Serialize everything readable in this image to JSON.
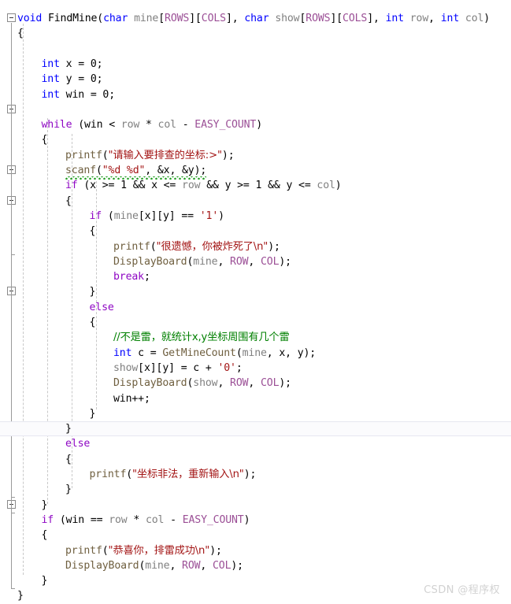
{
  "editor": {
    "background": "#ffffff",
    "current_line_index": 26,
    "font_size_px": 13.2,
    "line_height_px": 19.3,
    "colors": {
      "keyword": "#0000ff",
      "control_keyword": "#8f08c4",
      "macro": "#9b4f96",
      "string": "#a31515",
      "comment": "#008000",
      "function": "#6f5f3f",
      "variable": "#808080",
      "plain": "#000000",
      "squiggle": "#1f9d1f",
      "current_line_border": "#e6e7f0",
      "indent_guide": "#c8c8c8",
      "fold_line": "#9a9a9a",
      "watermark": "#d2d2d2"
    }
  },
  "gutter": {
    "fold_boxes": [
      {
        "line": 0,
        "state": "expanded"
      },
      {
        "line": 6,
        "state": "expanded"
      },
      {
        "line": 10,
        "state": "expanded"
      },
      {
        "line": 12,
        "state": "expanded"
      },
      {
        "line": 18,
        "state": "expanded"
      },
      {
        "line": 27,
        "state": "expanded"
      },
      {
        "line": 32,
        "state": "expanded"
      }
    ]
  },
  "code_lines": [
    {
      "indent": 0,
      "tokens": [
        {
          "t": "void",
          "c": "kw"
        },
        {
          "t": " ",
          "c": "plain"
        },
        {
          "t": "FindMine",
          "c": "plain"
        },
        {
          "t": "(",
          "c": "plain"
        },
        {
          "t": "char",
          "c": "kw"
        },
        {
          "t": " ",
          "c": "plain"
        },
        {
          "t": "mine",
          "c": "var"
        },
        {
          "t": "[",
          "c": "plain"
        },
        {
          "t": "ROWS",
          "c": "macro"
        },
        {
          "t": "][",
          "c": "plain"
        },
        {
          "t": "COLS",
          "c": "macro"
        },
        {
          "t": "], ",
          "c": "plain"
        },
        {
          "t": "char",
          "c": "kw"
        },
        {
          "t": " ",
          "c": "plain"
        },
        {
          "t": "show",
          "c": "var"
        },
        {
          "t": "[",
          "c": "plain"
        },
        {
          "t": "ROWS",
          "c": "macro"
        },
        {
          "t": "][",
          "c": "plain"
        },
        {
          "t": "COLS",
          "c": "macro"
        },
        {
          "t": "], ",
          "c": "plain"
        },
        {
          "t": "int",
          "c": "kw"
        },
        {
          "t": " ",
          "c": "plain"
        },
        {
          "t": "row",
          "c": "var"
        },
        {
          "t": ", ",
          "c": "plain"
        },
        {
          "t": "int",
          "c": "kw"
        },
        {
          "t": " ",
          "c": "plain"
        },
        {
          "t": "col",
          "c": "var"
        },
        {
          "t": ")",
          "c": "plain"
        }
      ]
    },
    {
      "indent": 0,
      "tokens": [
        {
          "t": "{",
          "c": "plain"
        }
      ]
    },
    {
      "indent": 0,
      "tokens": []
    },
    {
      "indent": 1,
      "tokens": [
        {
          "t": "int",
          "c": "kw"
        },
        {
          "t": " x = 0;",
          "c": "plain"
        }
      ]
    },
    {
      "indent": 1,
      "tokens": [
        {
          "t": "int",
          "c": "kw"
        },
        {
          "t": " y = 0;",
          "c": "plain"
        }
      ]
    },
    {
      "indent": 1,
      "tokens": [
        {
          "t": "int",
          "c": "kw"
        },
        {
          "t": " win = 0;",
          "c": "plain"
        }
      ]
    },
    {
      "indent": 0,
      "tokens": []
    },
    {
      "indent": 1,
      "tokens": [
        {
          "t": "while",
          "c": "kwctl"
        },
        {
          "t": " (",
          "c": "plain"
        },
        {
          "t": "win",
          "c": "plain"
        },
        {
          "t": " < ",
          "c": "plain"
        },
        {
          "t": "row",
          "c": "var"
        },
        {
          "t": " * ",
          "c": "plain"
        },
        {
          "t": "col",
          "c": "var"
        },
        {
          "t": " - ",
          "c": "plain"
        },
        {
          "t": "EASY_COUNT",
          "c": "macro"
        },
        {
          "t": ")",
          "c": "plain"
        }
      ]
    },
    {
      "indent": 1,
      "tokens": [
        {
          "t": "{",
          "c": "plain"
        }
      ]
    },
    {
      "indent": 2,
      "tokens": [
        {
          "t": "printf",
          "c": "fn"
        },
        {
          "t": "(",
          "c": "plain"
        },
        {
          "t": "\"请输入要排查的坐标:>\"",
          "c": "str cjk"
        },
        {
          "t": ");",
          "c": "plain"
        }
      ]
    },
    {
      "indent": 2,
      "squiggly": true,
      "tokens": [
        {
          "t": "scanf",
          "c": "fn"
        },
        {
          "t": "(",
          "c": "plain"
        },
        {
          "t": "\"%d %d\"",
          "c": "str"
        },
        {
          "t": ", &x, &y);",
          "c": "plain"
        }
      ]
    },
    {
      "indent": 2,
      "tokens": [
        {
          "t": "if",
          "c": "kwctl"
        },
        {
          "t": " (x >= 1 && x <= ",
          "c": "plain"
        },
        {
          "t": "row",
          "c": "var"
        },
        {
          "t": " && y >= 1 && y <= ",
          "c": "plain"
        },
        {
          "t": "col",
          "c": "var"
        },
        {
          "t": ")",
          "c": "plain"
        }
      ]
    },
    {
      "indent": 2,
      "tokens": [
        {
          "t": "{",
          "c": "plain"
        }
      ]
    },
    {
      "indent": 3,
      "tokens": [
        {
          "t": "if",
          "c": "kwctl"
        },
        {
          "t": " (",
          "c": "plain"
        },
        {
          "t": "mine",
          "c": "var"
        },
        {
          "t": "[x][y] == ",
          "c": "plain"
        },
        {
          "t": "'1'",
          "c": "str"
        },
        {
          "t": ")",
          "c": "plain"
        }
      ]
    },
    {
      "indent": 3,
      "tokens": [
        {
          "t": "{",
          "c": "plain"
        }
      ]
    },
    {
      "indent": 4,
      "tokens": [
        {
          "t": "printf",
          "c": "fn"
        },
        {
          "t": "(",
          "c": "plain"
        },
        {
          "t": "\"很遗憾，你被炸死了\\n\"",
          "c": "str cjk"
        },
        {
          "t": ");",
          "c": "plain"
        }
      ]
    },
    {
      "indent": 4,
      "tokens": [
        {
          "t": "DisplayBoard",
          "c": "fn"
        },
        {
          "t": "(",
          "c": "plain"
        },
        {
          "t": "mine",
          "c": "var"
        },
        {
          "t": ", ",
          "c": "plain"
        },
        {
          "t": "ROW",
          "c": "macro"
        },
        {
          "t": ", ",
          "c": "plain"
        },
        {
          "t": "COL",
          "c": "macro"
        },
        {
          "t": ");",
          "c": "plain"
        }
      ]
    },
    {
      "indent": 4,
      "tokens": [
        {
          "t": "break",
          "c": "kwctl"
        },
        {
          "t": ";",
          "c": "plain"
        }
      ]
    },
    {
      "indent": 3,
      "tokens": [
        {
          "t": "}",
          "c": "plain"
        }
      ]
    },
    {
      "indent": 3,
      "tokens": [
        {
          "t": "else",
          "c": "kwctl"
        }
      ]
    },
    {
      "indent": 3,
      "tokens": [
        {
          "t": "{",
          "c": "plain"
        }
      ]
    },
    {
      "indent": 4,
      "tokens": [
        {
          "t": "//不是雷，就统计x,y坐标周围有几个雷",
          "c": "cmt cjk"
        }
      ]
    },
    {
      "indent": 4,
      "tokens": [
        {
          "t": "int",
          "c": "kw"
        },
        {
          "t": " c = ",
          "c": "plain"
        },
        {
          "t": "GetMineCount",
          "c": "fn"
        },
        {
          "t": "(",
          "c": "plain"
        },
        {
          "t": "mine",
          "c": "var"
        },
        {
          "t": ", x, y);",
          "c": "plain"
        }
      ]
    },
    {
      "indent": 4,
      "tokens": [
        {
          "t": "show",
          "c": "var"
        },
        {
          "t": "[x][y] = c + ",
          "c": "plain"
        },
        {
          "t": "'0'",
          "c": "str"
        },
        {
          "t": ";",
          "c": "plain"
        }
      ]
    },
    {
      "indent": 4,
      "tokens": [
        {
          "t": "DisplayBoard",
          "c": "fn"
        },
        {
          "t": "(",
          "c": "plain"
        },
        {
          "t": "show",
          "c": "var"
        },
        {
          "t": ", ",
          "c": "plain"
        },
        {
          "t": "ROW",
          "c": "macro"
        },
        {
          "t": ", ",
          "c": "plain"
        },
        {
          "t": "COL",
          "c": "macro"
        },
        {
          "t": ");",
          "c": "plain"
        }
      ]
    },
    {
      "indent": 4,
      "tokens": [
        {
          "t": "win++;",
          "c": "plain"
        }
      ]
    },
    {
      "indent": 3,
      "tokens": [
        {
          "t": "}",
          "c": "plain"
        }
      ]
    },
    {
      "indent": 2,
      "current": true,
      "tokens": [
        {
          "t": "}",
          "c": "plain"
        }
      ]
    },
    {
      "indent": 2,
      "tokens": [
        {
          "t": "else",
          "c": "kwctl"
        }
      ]
    },
    {
      "indent": 2,
      "tokens": [
        {
          "t": "{",
          "c": "plain"
        }
      ]
    },
    {
      "indent": 3,
      "tokens": [
        {
          "t": "printf",
          "c": "fn"
        },
        {
          "t": "(",
          "c": "plain"
        },
        {
          "t": "\"坐标非法，重新输入\\n\"",
          "c": "str cjk"
        },
        {
          "t": ");",
          "c": "plain"
        }
      ]
    },
    {
      "indent": 2,
      "tokens": [
        {
          "t": "}",
          "c": "plain"
        }
      ]
    },
    {
      "indent": 1,
      "tokens": [
        {
          "t": "}",
          "c": "plain"
        }
      ]
    },
    {
      "indent": 1,
      "tokens": [
        {
          "t": "if",
          "c": "kwctl"
        },
        {
          "t": " (win == ",
          "c": "plain"
        },
        {
          "t": "row",
          "c": "var"
        },
        {
          "t": " * ",
          "c": "plain"
        },
        {
          "t": "col",
          "c": "var"
        },
        {
          "t": " - ",
          "c": "plain"
        },
        {
          "t": "EASY_COUNT",
          "c": "macro"
        },
        {
          "t": ")",
          "c": "plain"
        }
      ]
    },
    {
      "indent": 1,
      "tokens": [
        {
          "t": "{",
          "c": "plain"
        }
      ]
    },
    {
      "indent": 2,
      "tokens": [
        {
          "t": "printf",
          "c": "fn"
        },
        {
          "t": "(",
          "c": "plain"
        },
        {
          "t": "\"恭喜你，排雷成功\\n\"",
          "c": "str cjk"
        },
        {
          "t": ");",
          "c": "plain"
        }
      ]
    },
    {
      "indent": 2,
      "tokens": [
        {
          "t": "DisplayBoard",
          "c": "fn"
        },
        {
          "t": "(",
          "c": "plain"
        },
        {
          "t": "mine",
          "c": "var"
        },
        {
          "t": ", ",
          "c": "plain"
        },
        {
          "t": "ROW",
          "c": "macro"
        },
        {
          "t": ", ",
          "c": "plain"
        },
        {
          "t": "COL",
          "c": "macro"
        },
        {
          "t": ");",
          "c": "plain"
        }
      ]
    },
    {
      "indent": 1,
      "tokens": [
        {
          "t": "}",
          "c": "plain"
        }
      ]
    },
    {
      "indent": 0,
      "tokens": [
        {
          "t": "}",
          "c": "plain"
        }
      ]
    }
  ],
  "watermark": {
    "text": "CSDN @程序权"
  }
}
